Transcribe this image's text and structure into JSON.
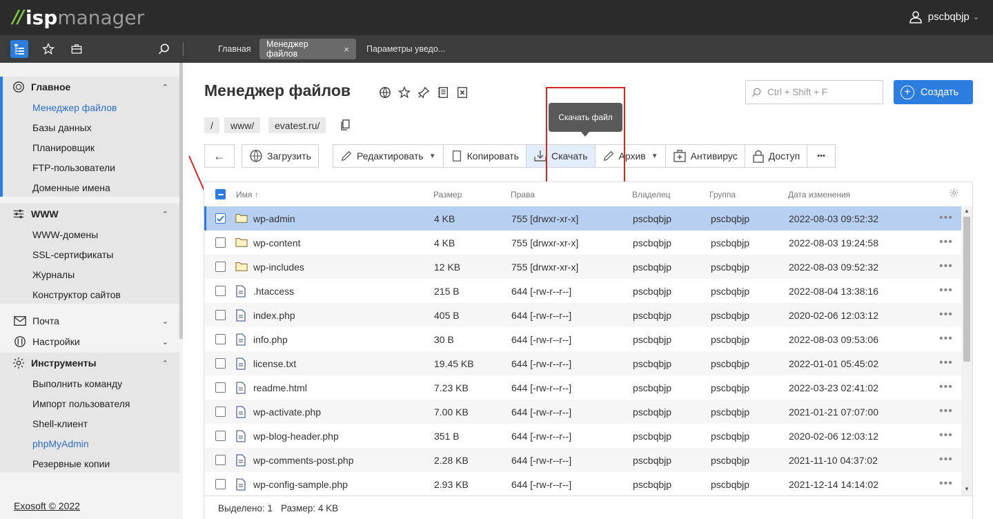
{
  "app": {
    "logo_mark": "//",
    "logo_isp": "isp",
    "logo_manager": "manager"
  },
  "user": {
    "name": "pscbqbjp"
  },
  "tabs": [
    {
      "label": "Главная"
    },
    {
      "label": "Менеджер файлов",
      "close": "×"
    },
    {
      "label": "Параметры уведо..."
    }
  ],
  "sidebar": {
    "groups": [
      {
        "title": "Главное",
        "caret": "⌃",
        "items": [
          "Менеджер файлов",
          "Базы данных",
          "Планировщик",
          "FTP-пользователи",
          "Доменные имена"
        ]
      },
      {
        "title": "WWW",
        "caret": "⌃",
        "items": [
          "WWW-домены",
          "SSL-сертификаты",
          "Журналы",
          "Конструктор сайтов"
        ]
      },
      {
        "title": "Почта",
        "caret": "⌄"
      },
      {
        "title": "Настройки",
        "caret": "⌄"
      },
      {
        "title": "Инструменты",
        "caret": "⌃",
        "items": [
          "Выполнить команду",
          "Импорт пользователя",
          "Shell-клиент",
          "phpMyAdmin",
          "Резервные копии"
        ]
      }
    ],
    "footer": "Exosoft © 2022"
  },
  "page": {
    "title": "Менеджер файлов",
    "search_placeholder": "Ctrl + Shift + F",
    "create_label": "Создать",
    "breadcrumbs": [
      "/",
      "www/",
      "evatest.ru/"
    ],
    "tooltip": "Скачать файл"
  },
  "toolbar": {
    "back": "←",
    "upload": "Загрузить",
    "edit": "Редактировать",
    "copy": "Копировать",
    "download": "Скачать",
    "archive": "Архив",
    "antivirus": "Антивирус",
    "access": "Доступ",
    "more": "•••"
  },
  "table": {
    "headers": {
      "name": "Имя ↑",
      "size": "Размер",
      "perms": "Права",
      "owner": "Владелец",
      "group": "Группа",
      "modified": "Дата изменения"
    },
    "rows": [
      {
        "name": "wp-admin",
        "type": "folder",
        "size": "4 KB",
        "perms": "755 [drwxr-xr-x]",
        "owner": "pscbqbjp",
        "group": "pscbqbjp",
        "modified": "2022-08-03 09:52:32",
        "selected": true
      },
      {
        "name": "wp-content",
        "type": "folder",
        "size": "4 KB",
        "perms": "755 [drwxr-xr-x]",
        "owner": "pscbqbjp",
        "group": "pscbqbjp",
        "modified": "2022-08-03 19:24:58"
      },
      {
        "name": "wp-includes",
        "type": "folder",
        "size": "12 KB",
        "perms": "755 [drwxr-xr-x]",
        "owner": "pscbqbjp",
        "group": "pscbqbjp",
        "modified": "2022-08-03 09:52:32"
      },
      {
        "name": ".htaccess",
        "type": "file",
        "size": "215 B",
        "perms": "644 [-rw-r--r--]",
        "owner": "pscbqbjp",
        "group": "pscbqbjp",
        "modified": "2022-08-04 13:38:16"
      },
      {
        "name": "index.php",
        "type": "file",
        "size": "405 B",
        "perms": "644 [-rw-r--r--]",
        "owner": "pscbqbjp",
        "group": "pscbqbjp",
        "modified": "2020-02-06 12:03:12"
      },
      {
        "name": "info.php",
        "type": "file",
        "size": "30 B",
        "perms": "644 [-rw-r--r--]",
        "owner": "pscbqbjp",
        "group": "pscbqbjp",
        "modified": "2022-08-03 09:53:06"
      },
      {
        "name": "license.txt",
        "type": "file",
        "size": "19.45 KB",
        "perms": "644 [-rw-r--r--]",
        "owner": "pscbqbjp",
        "group": "pscbqbjp",
        "modified": "2022-01-01 05:45:02"
      },
      {
        "name": "readme.html",
        "type": "file",
        "size": "7.23 KB",
        "perms": "644 [-rw-r--r--]",
        "owner": "pscbqbjp",
        "group": "pscbqbjp",
        "modified": "2022-03-23 02:41:02"
      },
      {
        "name": "wp-activate.php",
        "type": "file",
        "size": "7.00 KB",
        "perms": "644 [-rw-r--r--]",
        "owner": "pscbqbjp",
        "group": "pscbqbjp",
        "modified": "2021-01-21 07:07:00"
      },
      {
        "name": "wp-blog-header.php",
        "type": "file",
        "size": "351 B",
        "perms": "644 [-rw-r--r--]",
        "owner": "pscbqbjp",
        "group": "pscbqbjp",
        "modified": "2020-02-06 12:03:12"
      },
      {
        "name": "wp-comments-post.php",
        "type": "file",
        "size": "2.28 KB",
        "perms": "644 [-rw-r--r--]",
        "owner": "pscbqbjp",
        "group": "pscbqbjp",
        "modified": "2021-11-10 04:37:02"
      },
      {
        "name": "wp-config-sample.php",
        "type": "file",
        "size": "2.93 KB",
        "perms": "644 [-rw-r--r--]",
        "owner": "pscbqbjp",
        "group": "pscbqbjp",
        "modified": "2021-12-14 14:14:02"
      }
    ],
    "row_menu": "•••",
    "footer": {
      "selected": "Выделено: 1",
      "size": "Размер: 4 KB"
    }
  },
  "colors": {
    "accent": "#2b7de0",
    "annotation": "#d9261c",
    "selected_row": "#b7d0f2"
  }
}
